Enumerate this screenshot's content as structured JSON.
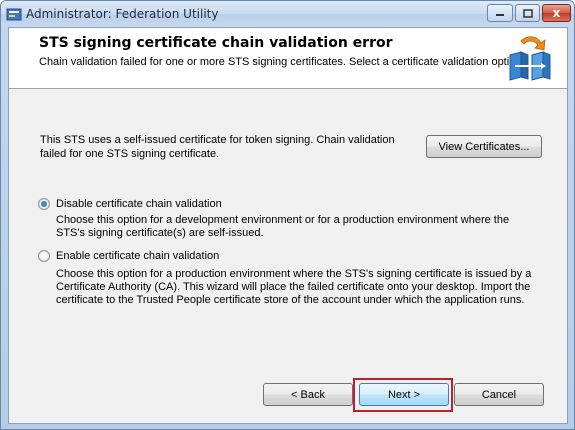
{
  "window": {
    "title": "Administrator: Federation Utility",
    "close_glyph": "x"
  },
  "header": {
    "title": "STS signing certificate chain validation error",
    "subtitle": "Chain validation failed for one or more STS signing certificates. Select a certificate validation option.",
    "icon": "federation-wizard-icon"
  },
  "body": {
    "info_text": "This STS uses a self-issued certificate for token signing. Chain validation failed for one STS signing certificate.",
    "view_button": "View Certificates...",
    "options": [
      {
        "label": "Disable certificate chain validation",
        "description": "Choose this option for a development environment or for a production environment where the STS's signing certificate(s) are self-issued.",
        "selected": true
      },
      {
        "label": "Enable certificate chain validation",
        "description": "Choose this option for a production environment where the STS's signing certificate is issued by a Certificate Authority (CA).  This wizard will place the failed certificate onto your desktop. Import the certificate to the Trusted People certificate store of the account under which the application runs.",
        "selected": false
      }
    ]
  },
  "footer": {
    "back": "< Back",
    "next": "Next >",
    "cancel": "Cancel",
    "highlight_color": "#b9222a"
  }
}
